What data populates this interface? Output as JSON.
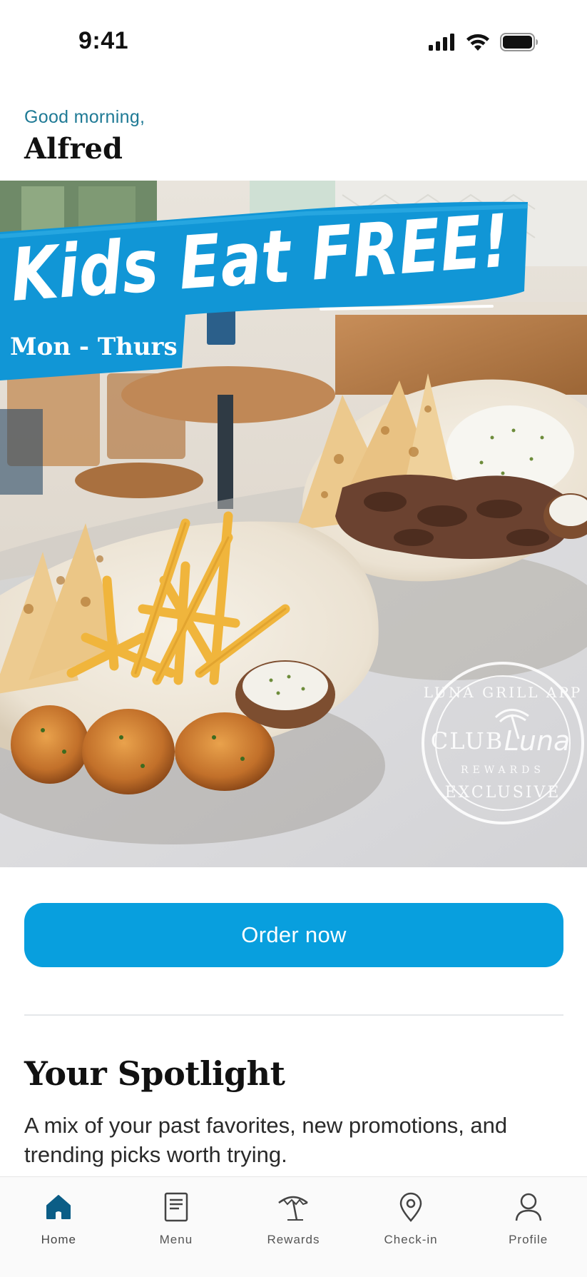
{
  "status_bar": {
    "time": "9:41"
  },
  "greeting": {
    "subtitle": "Good morning,",
    "name": "Alfred"
  },
  "promo": {
    "headline": "Kids Eat FREE!",
    "days": "Mon - Thurs",
    "badge": {
      "top": "LUNA GRILL APP",
      "club": "CLUB",
      "brand": "Luna",
      "rewards": "REWARDS",
      "bottom": "EXCLUSIVE"
    }
  },
  "order_button": {
    "label": "Order now"
  },
  "spotlight": {
    "title": "Your Spotlight",
    "description": "A mix of your past favorites, new promotions, and trending picks worth trying."
  },
  "tabs": [
    {
      "label": "Home",
      "icon": "home-icon",
      "active": true
    },
    {
      "label": "Menu",
      "icon": "menu-icon",
      "active": false
    },
    {
      "label": "Rewards",
      "icon": "umbrella-icon",
      "active": false
    },
    {
      "label": "Check-in",
      "icon": "location-pin-icon",
      "active": false
    },
    {
      "label": "Profile",
      "icon": "profile-icon",
      "active": false
    }
  ],
  "colors": {
    "accent": "#089fde",
    "greeting": "#1f7a95",
    "home_active": "#0b5d86"
  }
}
